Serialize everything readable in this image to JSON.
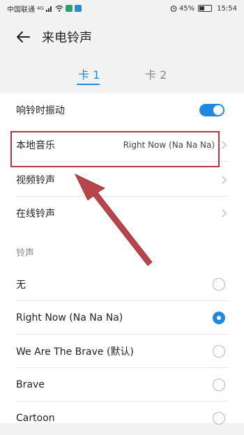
{
  "status": {
    "carrier": "中国联通",
    "signal_marker": "4G",
    "battery": "45%",
    "time": "15:54"
  },
  "header": {
    "title": "来电铃声"
  },
  "tabs": [
    {
      "label": "卡 1",
      "active": true
    },
    {
      "label": "卡 2",
      "active": false
    }
  ],
  "settings": [
    {
      "label": "响铃时振动",
      "type": "toggle",
      "on": true
    },
    {
      "label": "本地音乐",
      "value": "Right Now (Na Na Na)",
      "type": "nav"
    },
    {
      "label": "视频铃声",
      "value": "",
      "type": "nav"
    },
    {
      "label": "在线铃声",
      "value": "",
      "type": "nav"
    }
  ],
  "ringtone_section": {
    "label": "铃声"
  },
  "ringtones": [
    {
      "label": "无",
      "selected": false
    },
    {
      "label": "Right Now (Na Na Na)",
      "selected": true
    },
    {
      "label": "We Are The Brave (默认)",
      "selected": false
    },
    {
      "label": "Brave",
      "selected": false
    },
    {
      "label": "Cartoon",
      "selected": false
    }
  ],
  "colors": {
    "accent": "#1e88e5",
    "highlight": "#b3363c"
  }
}
